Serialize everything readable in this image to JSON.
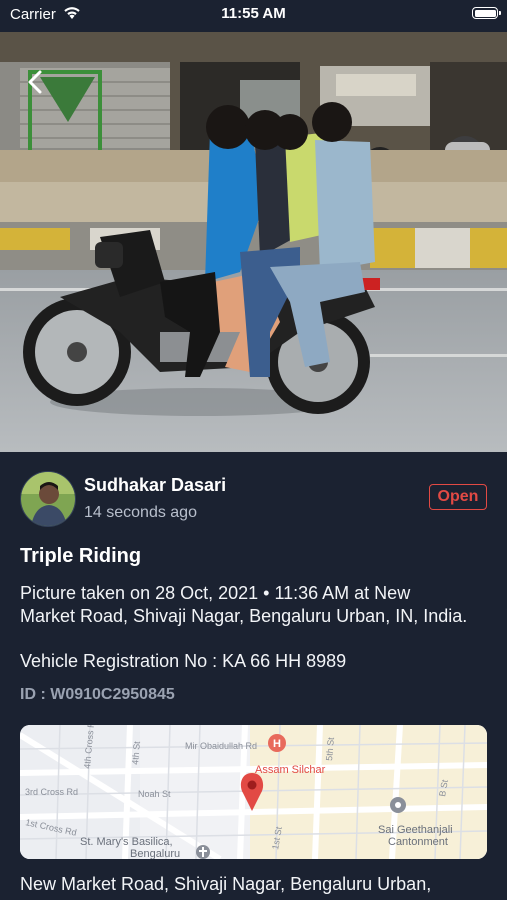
{
  "status_bar": {
    "carrier": "Carrier",
    "time": "11:55 AM"
  },
  "report": {
    "user_name": "Sudhakar Dasari",
    "time_ago": "14 seconds ago",
    "status": "Open",
    "status_color": "#e24a44",
    "title": "Triple Riding",
    "description": "Picture taken on 28 Oct, 2021 • 11:36 AM at New Market Road, Shivaji Nagar, Bengaluru Urban, IN, India.",
    "vehicle_registration": "Vehicle Registration No : KA 66 HH 8989",
    "report_id": "ID : W0910C2950845",
    "address": "New Market Road, Shivaji Nagar, Bengaluru Urban,"
  },
  "map": {
    "labels": {
      "mir_obaidullah": "Mir Obaidullah Rd",
      "assam_silchar": "Assam Silchar",
      "cross_rd_3": "3rd Cross Rd",
      "noah_st": "Noah St",
      "cross_rd_1": "1st Cross Rd",
      "st_marys": "St. Mary's Basilica,",
      "bengaluru": "Bengaluru",
      "sai_geethanjali": "Sai Geethanjali",
      "cantonment": "Cantonment",
      "st_1st": "1st St",
      "st_4th": "4th St",
      "rd_4th": "4th Cross Rd",
      "rd_5th": "5th St",
      "b_st": "B St"
    }
  },
  "colors": {
    "background": "#1b2231",
    "accent_red": "#e24a44"
  }
}
